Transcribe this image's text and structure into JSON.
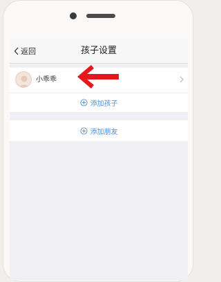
{
  "nav": {
    "back_label": "返回",
    "title": "孩子设置"
  },
  "children": [
    {
      "name": "小乖乖"
    }
  ],
  "actions": {
    "add_child_label": "添加孩子",
    "add_friend_label": "添加朋友"
  },
  "colors": {
    "accent": "#4a90d9",
    "arrow": "#e8151b"
  },
  "icons": {
    "back": "chevron-left-icon",
    "row_chevron": "chevron-right-icon",
    "add": "plus-circle-icon",
    "avatar": "avatar"
  }
}
